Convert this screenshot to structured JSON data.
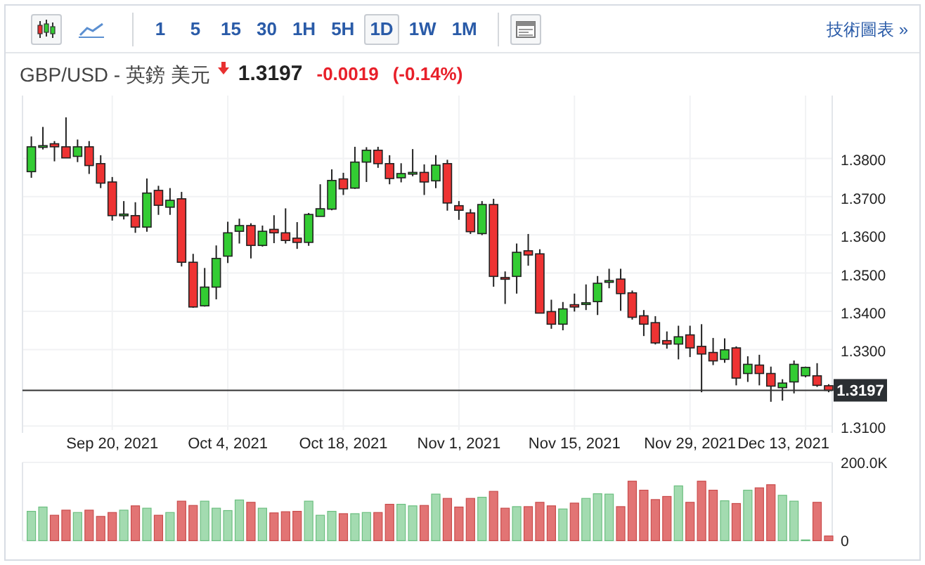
{
  "toolbar": {
    "chart_types": [
      {
        "kind": "candles",
        "selected": true
      },
      {
        "kind": "line",
        "selected": false
      }
    ],
    "intervals": [
      {
        "label": "1",
        "selected": false
      },
      {
        "label": "5",
        "selected": false
      },
      {
        "label": "15",
        "selected": false
      },
      {
        "label": "30",
        "selected": false
      },
      {
        "label": "1H",
        "selected": false
      },
      {
        "label": "5H",
        "selected": false
      },
      {
        "label": "1D",
        "selected": true
      },
      {
        "label": "1W",
        "selected": false
      },
      {
        "label": "1M",
        "selected": false
      }
    ],
    "link": "技術圖表 »"
  },
  "quote": {
    "symbol": "GBP/USD - 英鎊 美元",
    "falling": true,
    "price": "1.3197",
    "change": "-0.0019",
    "change_percent": "(-0.14%)"
  },
  "price_chart": {
    "price_axis": [
      "1.3800",
      "1.3700",
      "1.3600",
      "1.3500",
      "1.3400",
      "1.3300",
      "1.3100"
    ],
    "last_price_tag": "1.3197",
    "date_axis": [
      "Sep 20, 2021",
      "Oct 4, 2021",
      "Oct 18, 2021",
      "Nov 1, 2021",
      "Nov 15, 2021",
      "Nov 29, 2021",
      "Dec 13, 2021"
    ]
  },
  "volume_chart": {
    "chart_data": {
      "type": "bar",
      "grid": true,
      "ylim": [
        0,
        200000
      ],
      "yticks": [
        {
          "value": 0,
          "label": "0"
        },
        {
          "value": 200000,
          "label": "200.0K"
        }
      ],
      "values": [
        75000,
        86000,
        65000,
        78000,
        72000,
        78000,
        62000,
        72000,
        78000,
        89000,
        83000,
        65000,
        72000,
        101000,
        90000,
        101000,
        83000,
        77000,
        104000,
        98000,
        83000,
        71000,
        74000,
        75000,
        101000,
        65000,
        75000,
        69000,
        69000,
        72000,
        72000,
        93000,
        93000,
        89000,
        90000,
        119000,
        108000,
        86000,
        108000,
        111000,
        126000,
        83000,
        87000,
        87000,
        98000,
        89000,
        81000,
        96000,
        108000,
        120000,
        119000,
        87000,
        152000,
        129000,
        105000,
        113000,
        140000,
        98000,
        152000,
        129000,
        102000,
        95000,
        129000,
        135000,
        143000,
        116000,
        101000,
        2000,
        98000,
        12000
      ]
    }
  }
}
